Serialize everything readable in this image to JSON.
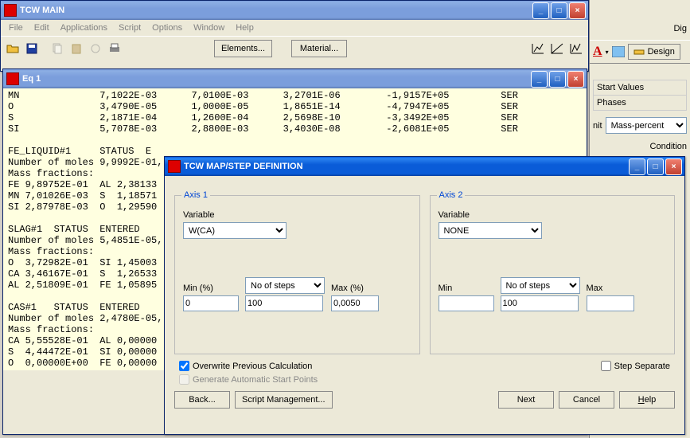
{
  "main_window": {
    "title": "TCW MAIN",
    "menus": [
      "File",
      "Edit",
      "Applications",
      "Script",
      "Options",
      "Window",
      "Help"
    ],
    "buttons": {
      "elements": "Elements...",
      "material": "Material..."
    }
  },
  "eq_window": {
    "title": "Eq 1",
    "table": [
      [
        "MN",
        "7,1022E-03",
        "7,0100E-03",
        "3,2701E-06",
        "-1,9157E+05",
        "SER"
      ],
      [
        "O",
        "3,4790E-05",
        "1,0000E-05",
        "1,8651E-14",
        "-4,7947E+05",
        "SER"
      ],
      [
        "S",
        "2,1871E-04",
        "1,2600E-04",
        "2,5698E-10",
        "-3,3492E+05",
        "SER"
      ],
      [
        "SI",
        "5,7078E-03",
        "2,8800E-03",
        "3,4030E-08",
        "-2,6081E+05",
        "SER"
      ]
    ],
    "body_lines": [
      "",
      "FE_LIQUID#1     STATUS  E",
      "Number of moles 9,9992E-01, ",
      "Mass fractions:",
      "FE 9,89752E-01  AL 2,38133",
      "MN 7,01026E-03  S  1,18571",
      "SI 2,87978E-03  O  1,29590",
      "",
      "SLAG#1  STATUS  ENTERED",
      "Number of moles 5,4851E-05, ",
      "Mass fractions:",
      "O  3,72982E-01  SI 1,45003",
      "CA 3,46167E-01  S  1,26533",
      "AL 2,51809E-01  FE 1,05895",
      "",
      "CAS#1   STATUS  ENTERED",
      "Number of moles 2,4780E-05, ",
      "Mass fractions:",
      "CA 5,55528E-01  AL 0,00000",
      "S  4,44472E-01  SI 0,00000",
      "O  0,00000E+00  FE 0,00000"
    ]
  },
  "mapstep": {
    "title": "TCW MAP/STEP DEFINITION",
    "axis1": {
      "legend": "Axis 1",
      "var_label": "Variable",
      "var_value": "W(CA)",
      "min_label": "Min  (%)",
      "min_value": "0",
      "steps_label": "No of steps",
      "steps_value": "100",
      "max_label": "Max  (%)",
      "max_value": "0,0050"
    },
    "axis2": {
      "legend": "Axis 2",
      "var_label": "Variable",
      "var_value": "NONE",
      "min_label": "Min",
      "min_value": "",
      "steps_label": "No of steps",
      "steps_value": "100",
      "max_label": "Max",
      "max_value": ""
    },
    "overwrite": "Overwrite Previous Calculation",
    "generate": "Generate Automatic Start Points",
    "step_sep": "Step Separate",
    "back": "Back...",
    "script": "Script Management...",
    "next": "Next",
    "cancel": "Cancel",
    "help": "Help"
  },
  "right_panel": {
    "design": "Design",
    "start_values": "Start Values",
    "phases": "Phases",
    "unit_label": "nit",
    "unit_value": "Mass-percent",
    "condition": "Condition",
    "dig": "Dig"
  }
}
